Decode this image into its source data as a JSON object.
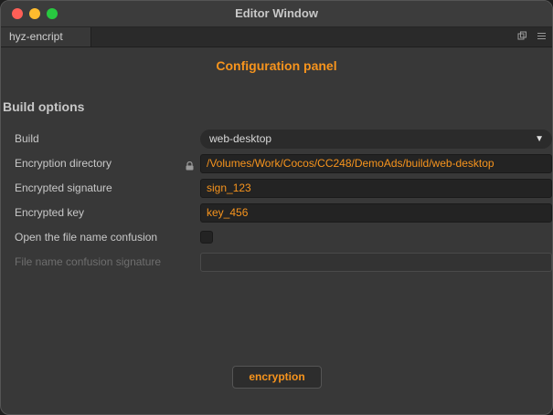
{
  "window": {
    "title": "Editor Window",
    "controls": [
      "close",
      "minimize",
      "maximize"
    ]
  },
  "tab": {
    "label": "hyz-encript",
    "icons": [
      "window-icon",
      "menu-icon"
    ]
  },
  "panel": {
    "title": "Configuration panel",
    "section_title": "Build options"
  },
  "form": {
    "build": {
      "label": "Build",
      "value": "web-desktop"
    },
    "encryption_directory": {
      "label": "Encryption directory",
      "value": "/Volumes/Work/Cocos/CC248/DemoAds/build/web-desktop",
      "icon": "lock-icon"
    },
    "encrypted_signature": {
      "label": "Encrypted signature",
      "value": "sign_123"
    },
    "encrypted_key": {
      "label": "Encrypted key",
      "value": "key_456"
    },
    "file_name_confusion": {
      "label": "Open the file name confusion",
      "checked": false
    },
    "confusion_signature": {
      "label": "File name confusion signature",
      "value": "",
      "disabled": true
    }
  },
  "actions": {
    "encrypt_label": "encryption"
  },
  "colors": {
    "accent": "#f7941d",
    "background": "#383838",
    "field": "#232323"
  }
}
